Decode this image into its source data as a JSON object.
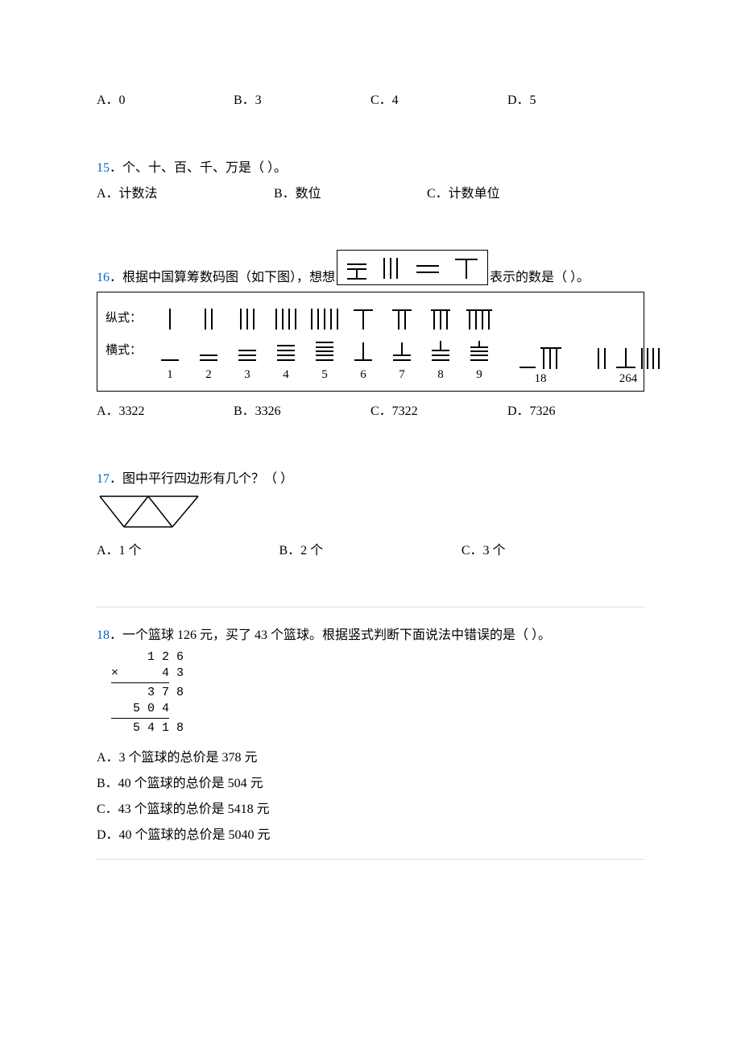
{
  "q14": {
    "opts": {
      "a": "A．0",
      "b": "B．3",
      "c": "C．4",
      "d": "D．5"
    }
  },
  "q15": {
    "num": "15",
    "stem": "．个、十、百、千、万是（   ）。",
    "opts": {
      "a": "A．计数法",
      "b": "B．数位",
      "c": "C．计数单位"
    }
  },
  "q16": {
    "num": "16",
    "stem_pre": "．根据中国算筹数码图（如下图），想想",
    "stem_post": "表示的数是（  ）。",
    "row_v_label": "纵式：",
    "row_h_label": "横式：",
    "nums": [
      "1",
      "2",
      "3",
      "4",
      "5",
      "6",
      "7",
      "8",
      "9"
    ],
    "ex1": "18",
    "ex2": "264",
    "opts": {
      "a": "A．3322",
      "b": "B．3326",
      "c": "C．7322",
      "d": "D．7326"
    }
  },
  "q17": {
    "num": "17",
    "stem": "．图中平行四边形有几个？（   ）",
    "opts": {
      "a": "A．1 个",
      "b": "B．2 个",
      "c": "C．3 个"
    }
  },
  "q18": {
    "num": "18",
    "stem": "．一个篮球 126 元，买了 43 个篮球。根据竖式判断下面说法中错误的是（  ）。",
    "calc": {
      "l1": "       1 2 6",
      "l2": "  ×      4 3",
      "l3": "       3 7 8",
      "l4": "     5 0 4",
      "l5": "     5 4 1 8"
    },
    "opts": {
      "a": "A．3 个篮球的总价是 378 元",
      "b": "B．40 个篮球的总价是 504 元",
      "c": "C．43 个篮球的总价是 5418 元",
      "d": "D．40 个篮球的总价是 5040 元"
    }
  }
}
